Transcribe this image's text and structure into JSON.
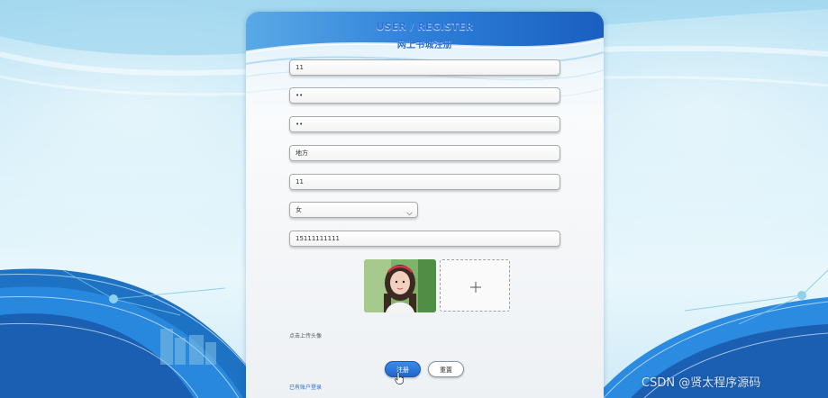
{
  "header": {
    "title_en": "USER / REGISTER",
    "title_zh": "网上书城注册"
  },
  "form": {
    "fields": [
      {
        "name": "username",
        "value": "11"
      },
      {
        "name": "password",
        "value": "••"
      },
      {
        "name": "confirm-password",
        "value": "••"
      },
      {
        "name": "nickname",
        "value": "地方"
      },
      {
        "name": "age",
        "value": "11"
      }
    ],
    "gender": {
      "value": "女"
    },
    "phone": {
      "value": "15111111111"
    }
  },
  "upload": {
    "hint": "点击上传头像"
  },
  "actions": {
    "register_label": "注册",
    "reset_label": "重置",
    "login_link": "已有账户登录"
  },
  "watermark": "CSDN @贤太程序源码",
  "colors": {
    "accent": "#2a6fd6",
    "primary_button": "#1f66c9"
  },
  "icons": [
    "chevron-down-icon",
    "plus-icon",
    "cursor-icon"
  ]
}
